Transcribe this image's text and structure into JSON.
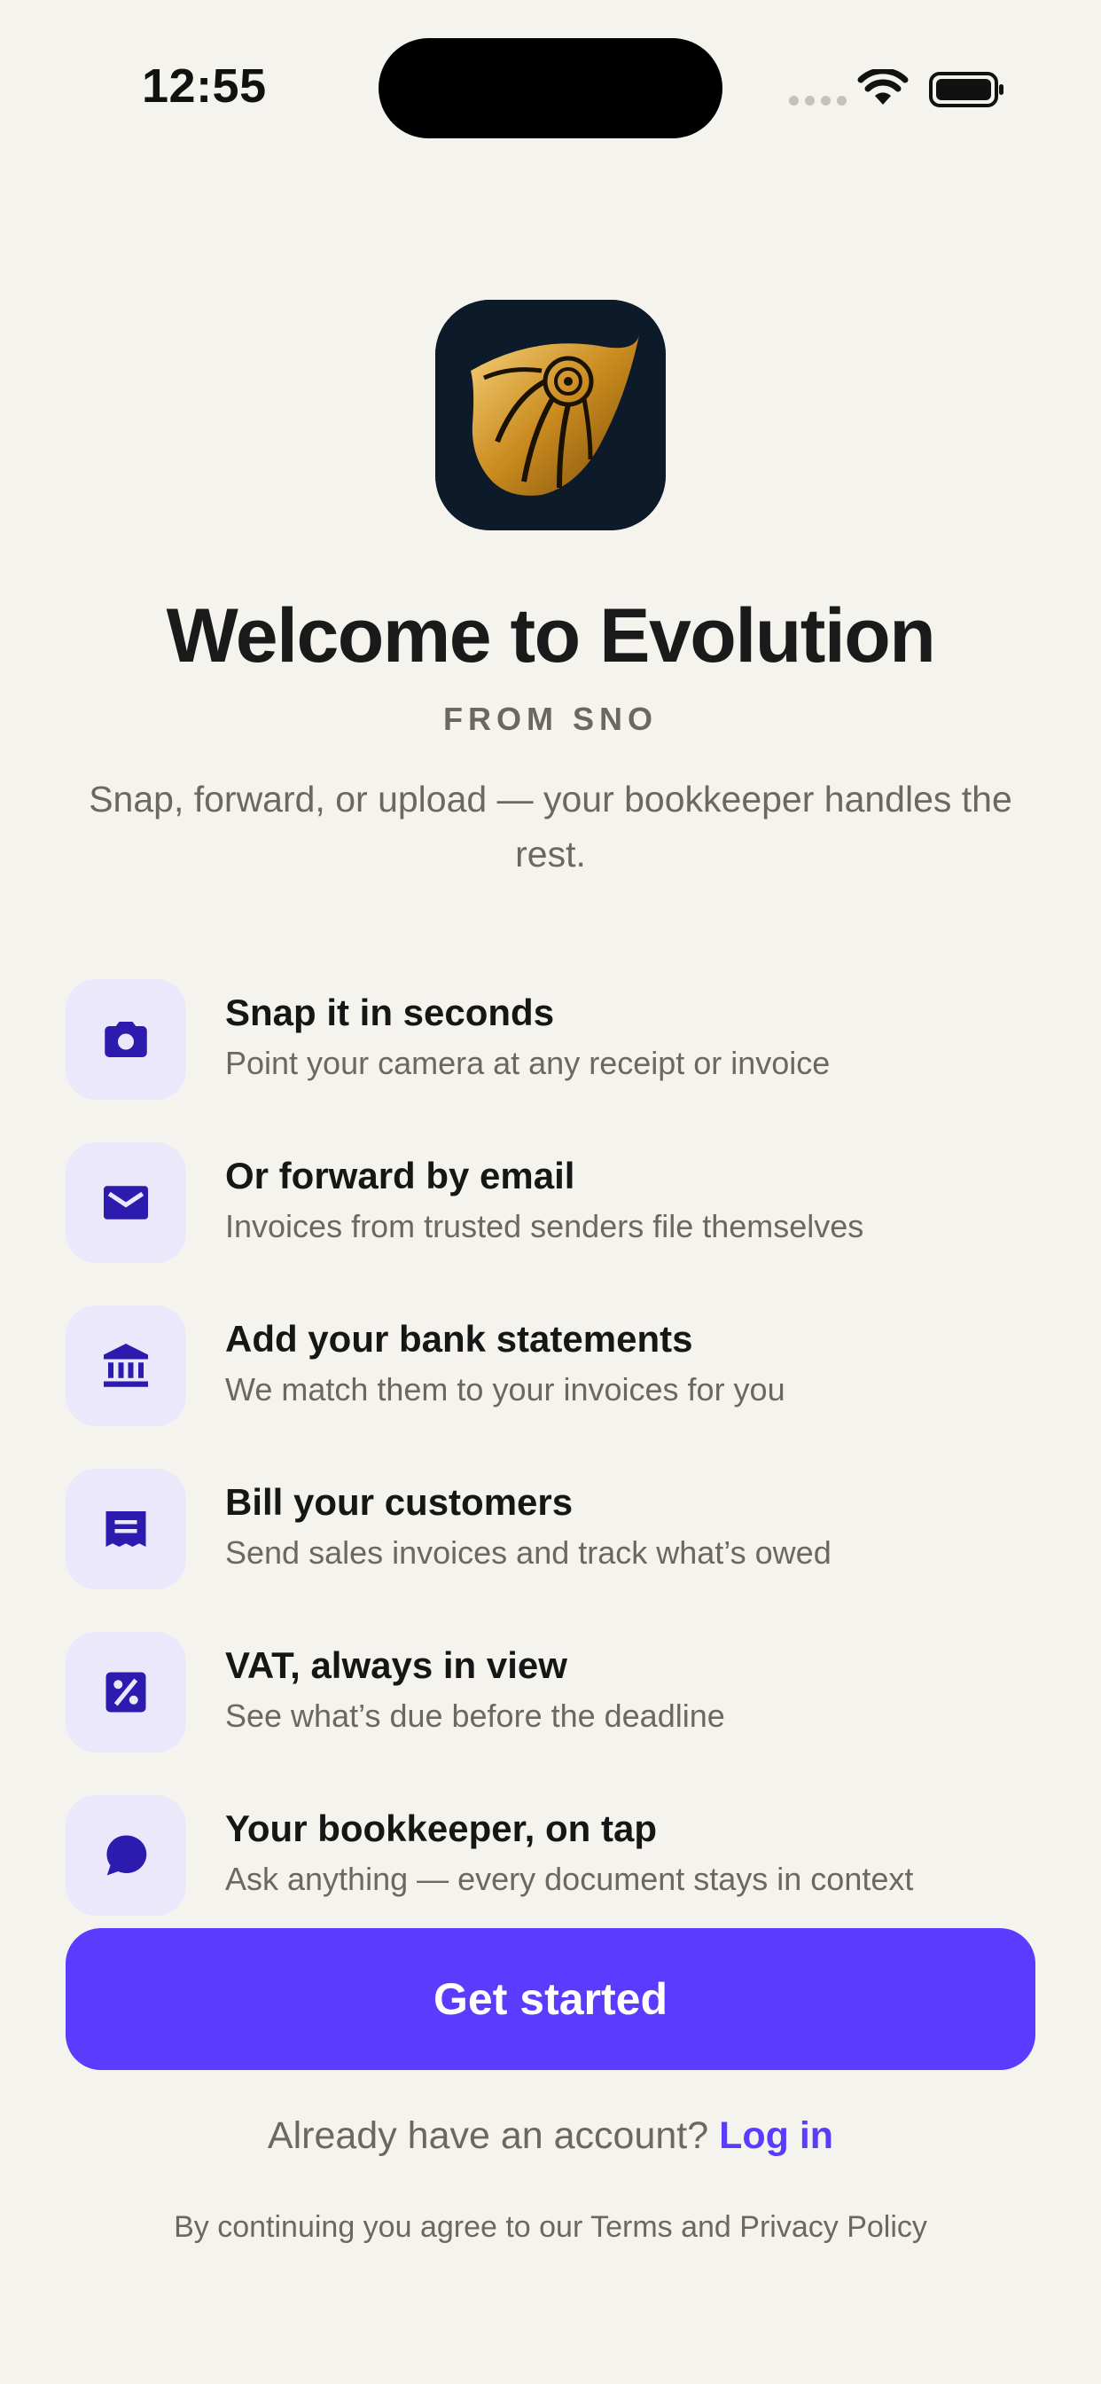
{
  "status_bar": {
    "time": "12:55",
    "icons": [
      "cellular-signal-icon",
      "wifi-icon",
      "battery-icon"
    ]
  },
  "app_icon": {
    "name": "nautilus-app-icon"
  },
  "header": {
    "title": "Welcome to Evolution",
    "subtitle": "FROM SNO",
    "tagline": "Snap, forward, or upload — your bookkeeper handles the rest."
  },
  "features": [
    {
      "icon": "camera-icon",
      "title": "Snap it in seconds",
      "description": "Point your camera at any receipt or invoice"
    },
    {
      "icon": "envelope-icon",
      "title": "Or forward by email",
      "description": "Invoices from trusted senders file themselves"
    },
    {
      "icon": "bank-icon",
      "title": "Add your bank statements",
      "description": "We match them to your invoices for you"
    },
    {
      "icon": "receipt-icon",
      "title": "Bill your customers",
      "description": "Send sales invoices and track what’s owed"
    },
    {
      "icon": "percent-icon",
      "title": "VAT, always in view",
      "description": "See what’s due before the deadline"
    },
    {
      "icon": "chat-bubble-icon",
      "title": "Your bookkeeper, on tap",
      "description": "Ask anything — every document stays in context"
    }
  ],
  "actions": {
    "get_started_label": "Get started",
    "login_prompt": "Already have an account?",
    "login_label": "Log in"
  },
  "legal": "By continuing you agree to our Terms and Privacy Policy",
  "colors": {
    "background": "#f5f3ee",
    "accent": "#5b3cff",
    "icon_tile": "#ebe8fb",
    "icon_glyph": "#2d1bb0"
  }
}
